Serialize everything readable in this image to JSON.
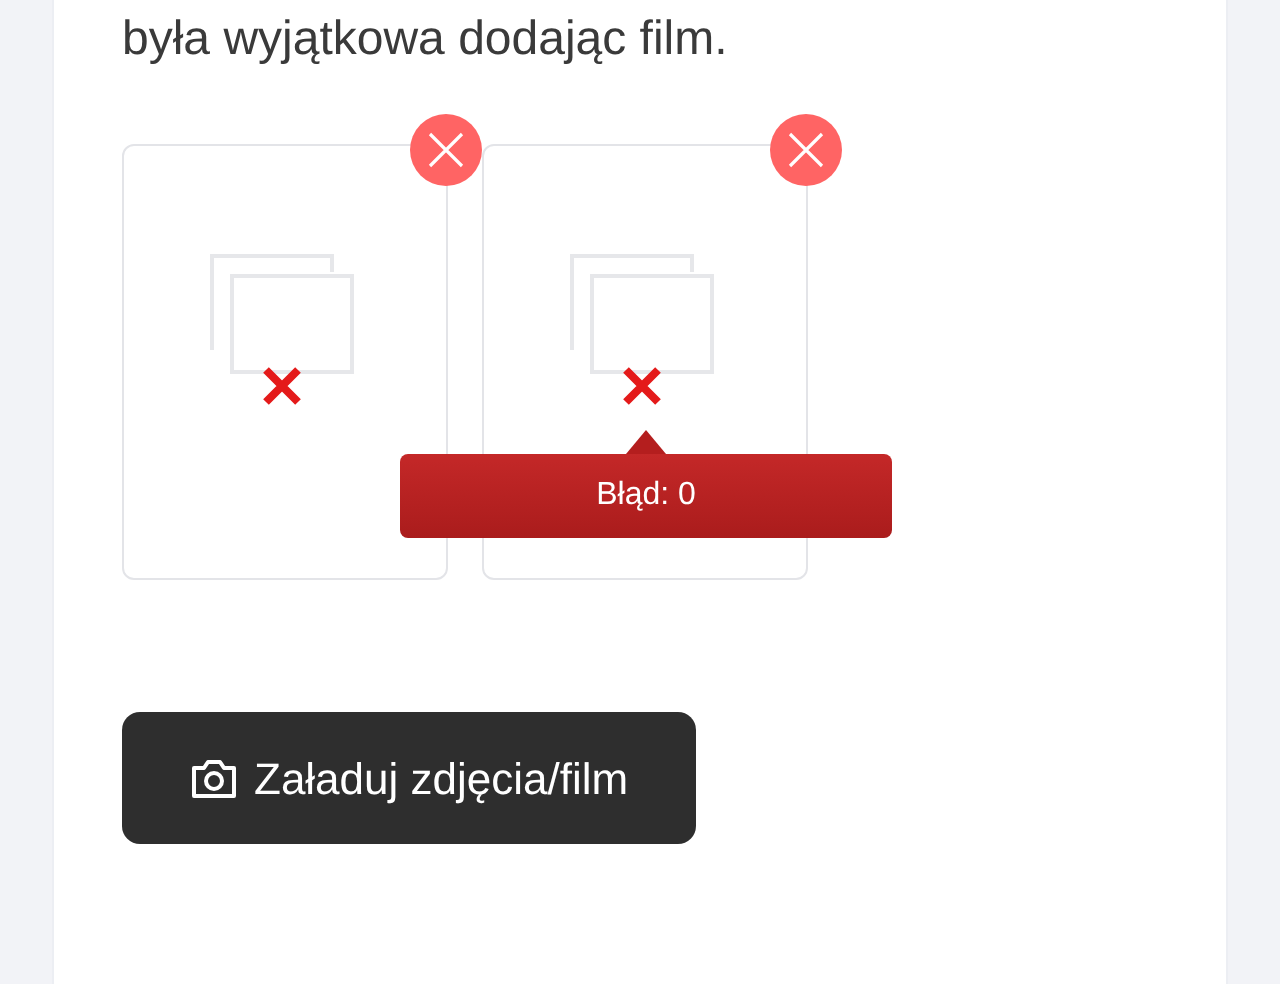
{
  "intro_text": "była wyjątkowa dodając film.",
  "media_items": [
    {
      "kind": "broken"
    },
    {
      "kind": "broken",
      "tooltip": "Błąd: 0"
    }
  ],
  "upload_button": {
    "label": "Załaduj zdjęcia/film"
  }
}
